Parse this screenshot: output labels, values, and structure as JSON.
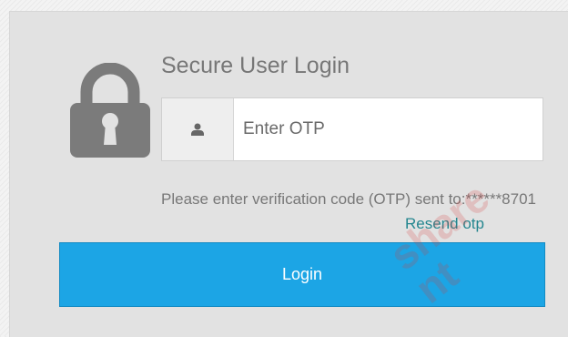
{
  "login_form": {
    "title": "Secure User Login",
    "otp_input": {
      "placeholder": "Enter OTP",
      "value": ""
    },
    "message": "Please enter verification code (OTP) sent to:******8701",
    "resend_label": "Resend otp",
    "login_label": "Login"
  },
  "watermark": {
    "lines": [
      "share",
      "nt"
    ]
  },
  "icons": {
    "lock": "lock-icon",
    "user": "user-icon"
  },
  "colors": {
    "panel_background": "#e2e2e2",
    "lock_icon": "#7b7b7b",
    "login_button": "#1ca5e5",
    "resend_link": "#24868f",
    "watermark": "#d73737"
  }
}
